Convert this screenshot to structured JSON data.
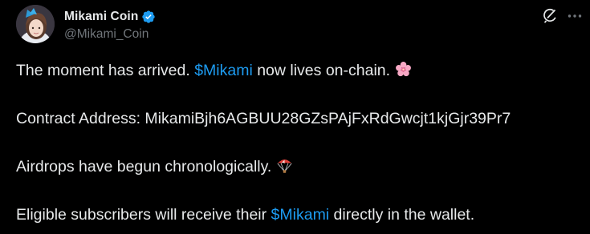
{
  "author": {
    "display_name": "Mikami Coin",
    "handle": "@Mikami_Coin",
    "verified": true
  },
  "icons": {
    "avatar": "profile-photo",
    "verified": "verified-badge-icon",
    "grok": "grok-icon",
    "more": "more-options-icon"
  },
  "tweet": {
    "line1": {
      "before": "The moment has arrived. ",
      "cashtag": "$Mikami",
      "after": " now lives on-chain.",
      "emoji": "cherry-blossom-icon"
    },
    "line2": "Contract Address: MikamiBjh6AGBUU28GZsPAjFxRdGwcjt1kjGjr39Pr7",
    "line3": {
      "text": "Airdrops have begun chronologically.",
      "emoji": "parachute-icon"
    },
    "line4": {
      "before": "Eligible subscribers will receive their ",
      "cashtag": "$Mikami",
      "after": " directly in the wallet."
    }
  },
  "colors": {
    "background": "#000000",
    "text": "#e7e9ea",
    "secondary": "#71767b",
    "link": "#1d9bf0"
  }
}
